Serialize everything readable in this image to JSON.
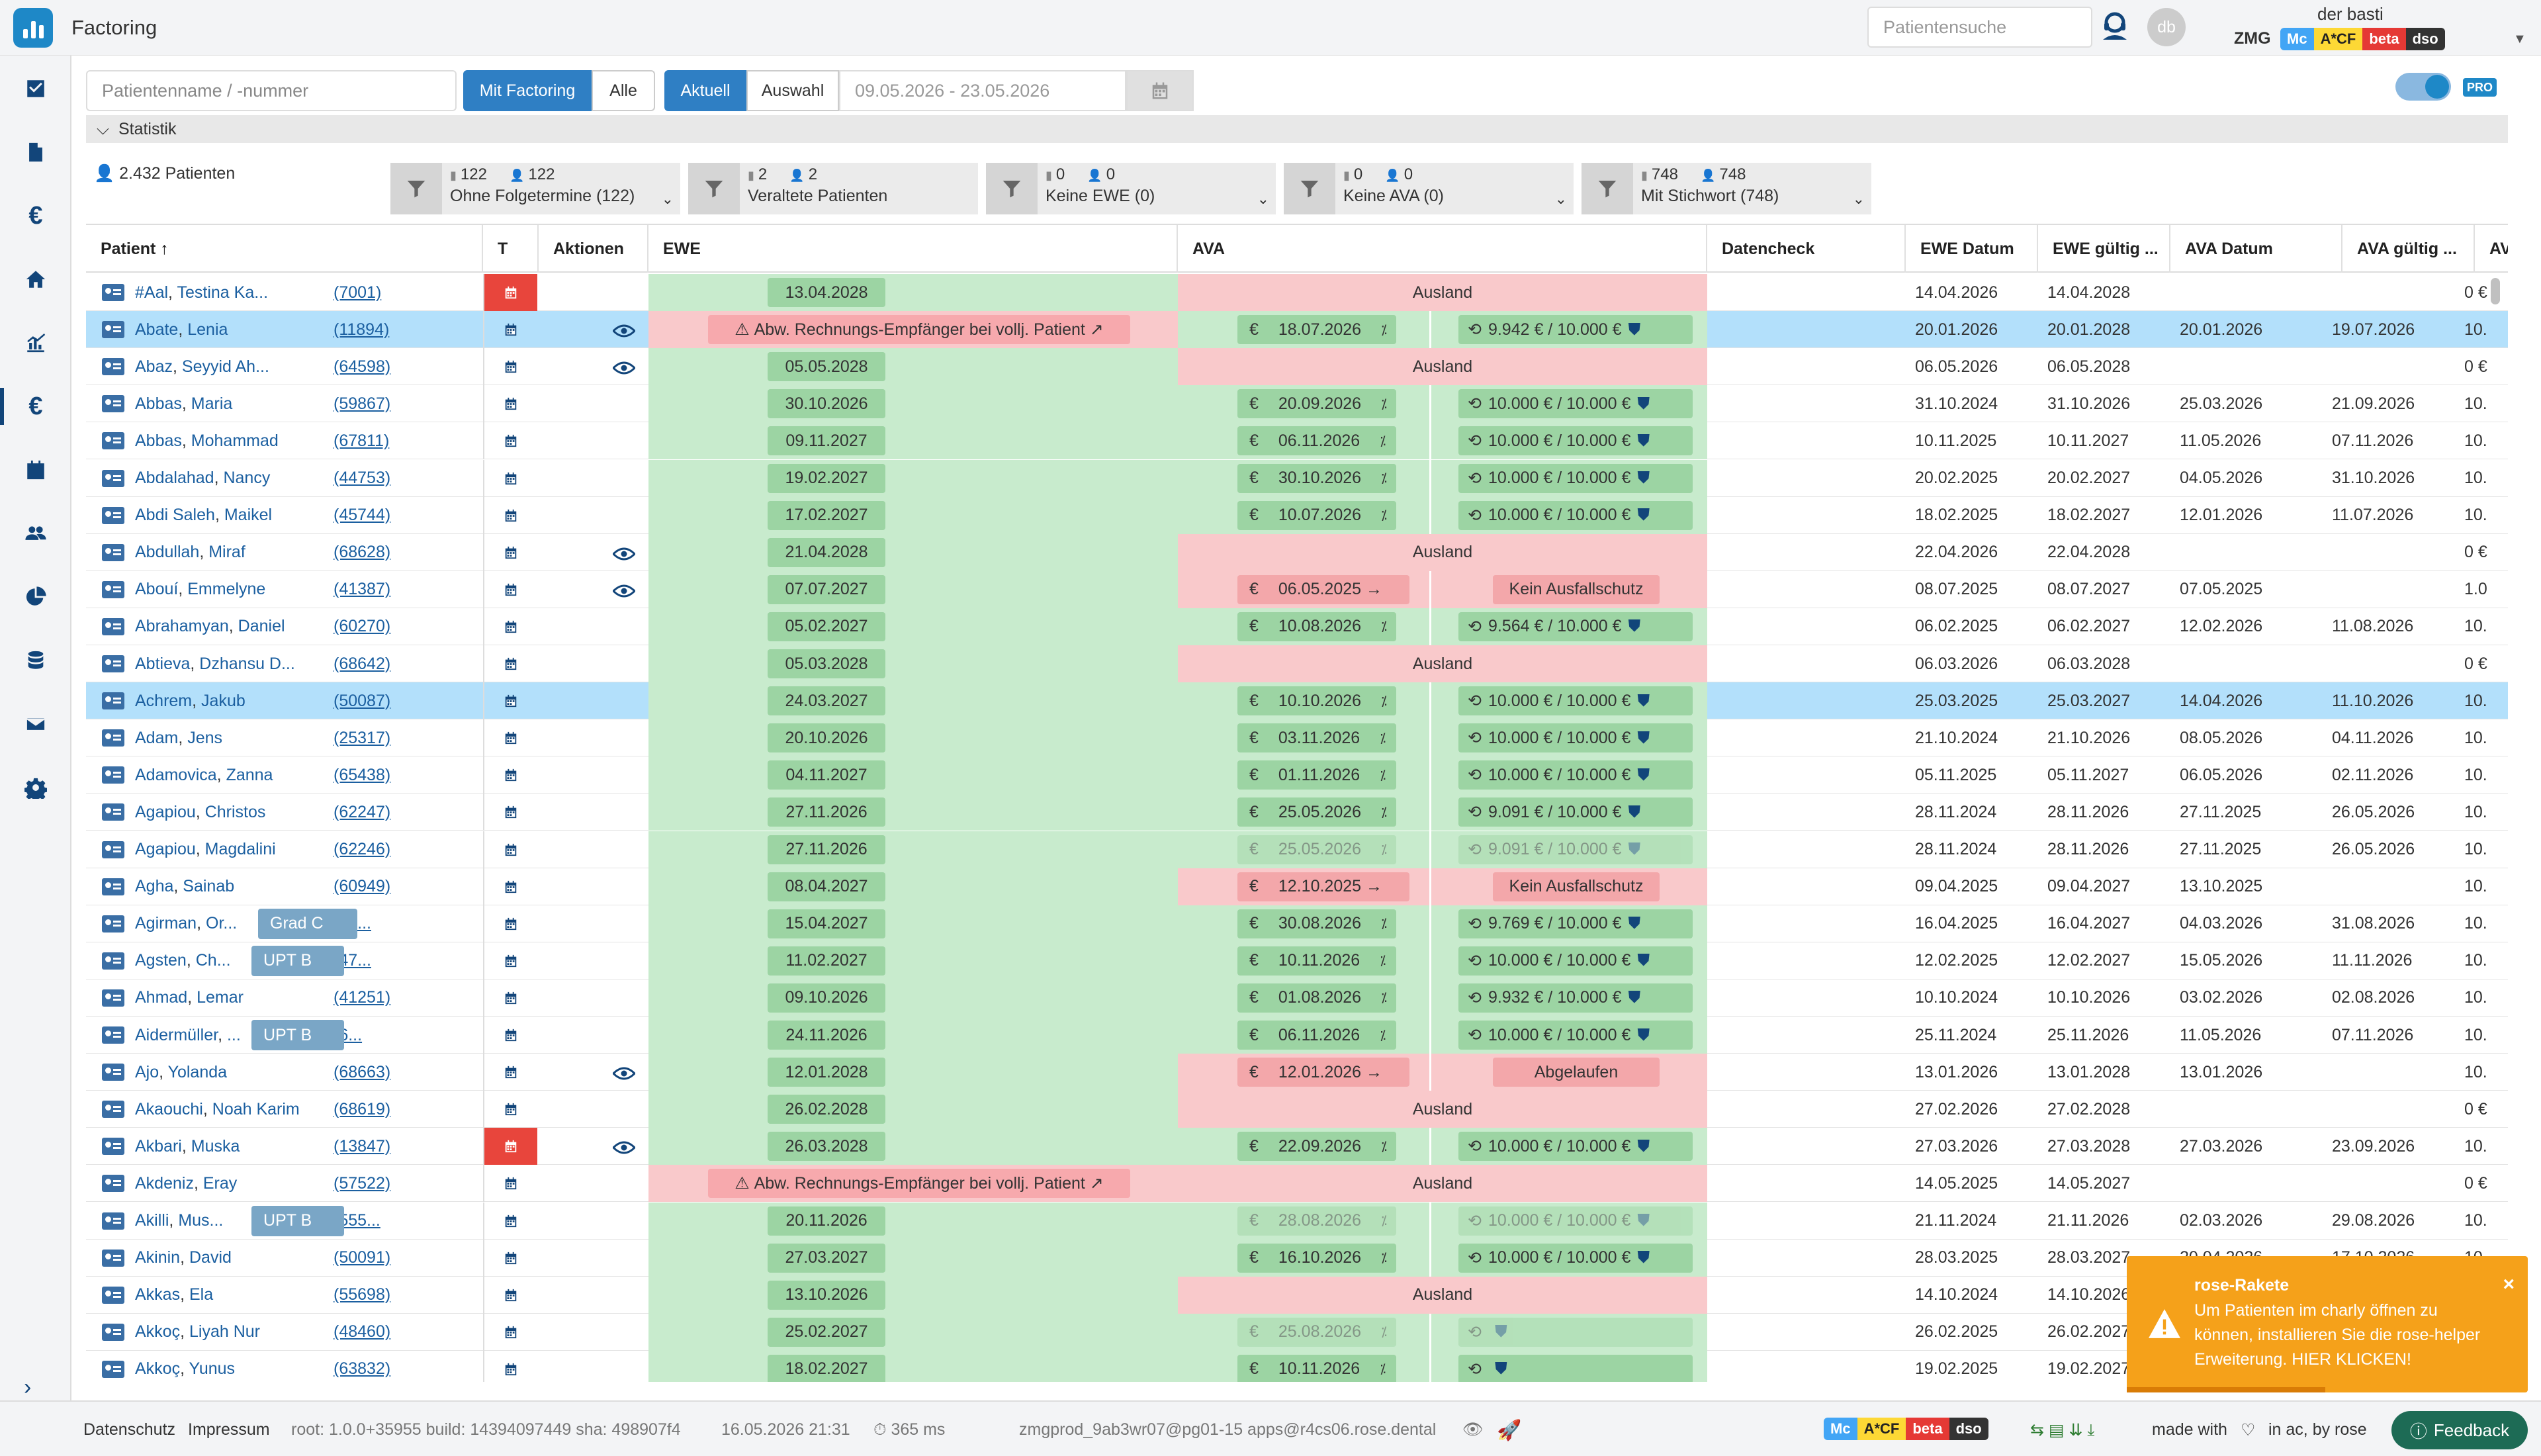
{
  "header": {
    "title": "Factoring",
    "search_placeholder": "Patientensuche",
    "avatar_initials": "db",
    "user_name": "der basti",
    "tenant": "ZMG",
    "badges": [
      "Mc",
      "A*CF",
      "beta",
      "dso"
    ]
  },
  "filters": {
    "name_placeholder": "Patientenname / -nummer",
    "mode_options": [
      "Mit Factoring",
      "Alle"
    ],
    "mode_selected": "Mit Factoring",
    "period_options": [
      "Aktuell",
      "Auswahl"
    ],
    "period_selected": "Aktuell",
    "date_range": "09.05.2026 - 23.05.2026",
    "pro_label": "PRO"
  },
  "statistics": {
    "title": "Statistik",
    "total": "2.432 Patienten",
    "filters": [
      {
        "count_a": "122",
        "count_b": "122",
        "selected": "Ohne Folgetermine (122)"
      },
      {
        "count_a": "2",
        "count_b": "2",
        "selected": "Veraltete Patienten"
      },
      {
        "count_a": "0",
        "count_b": "0",
        "selected": "Keine EWE (0)"
      },
      {
        "count_a": "0",
        "count_b": "0",
        "selected": "Keine AVA (0)"
      },
      {
        "count_a": "748",
        "count_b": "748",
        "selected": "Mit Stichwort (748)"
      }
    ]
  },
  "table": {
    "columns": [
      "Patient ↑",
      "T",
      "Aktionen",
      "EWE",
      "AVA",
      "Datencheck",
      "EWE Datum",
      "EWE gültig ...",
      "AVA Datum",
      "AVA gültig ...",
      "AVA B"
    ],
    "rows": [
      {
        "last": "#Aal",
        "first": "Testina Ka...",
        "num": "(7001)",
        "t_red": true,
        "eye": false,
        "ewe": "13.04.2028",
        "ewe_type": "green",
        "ava_type": "red-center",
        "ava_text": "Ausland",
        "ewe_datum": "14.04.2026",
        "ewe_gueltig": "14.04.2028",
        "ava_datum": "",
        "ava_gueltig": "",
        "ava_b": "0 €"
      },
      {
        "last": "Abate",
        "first": "Lenia",
        "num": "(11894)",
        "sel": true,
        "eye": true,
        "ewe": "Abw. Rechnungs-Empfänger bei vollj. Patient",
        "ewe_type": "warn",
        "ava_type": "green",
        "ava_a": "18.07.2026",
        "ava_b": "9.942 €  /  10.000 €",
        "ewe_datum": "20.01.2026",
        "ewe_gueltig": "20.01.2028",
        "ava_datum": "20.01.2026",
        "ava_gueltig": "19.07.2026",
        "ava_b_col": "10."
      },
      {
        "last": "Abaz",
        "first": "Seyyid Ah...",
        "num": "(64598)",
        "eye": true,
        "ewe": "05.05.2028",
        "ewe_type": "green",
        "ava_type": "red-center",
        "ava_text": "Ausland",
        "ewe_datum": "06.05.2026",
        "ewe_gueltig": "06.05.2028",
        "ava_datum": "",
        "ava_gueltig": "",
        "ava_b": "0 €"
      },
      {
        "last": "Abbas",
        "first": "Maria",
        "num": "(59867)",
        "ewe": "30.10.2026",
        "ewe_type": "green",
        "ava_type": "green",
        "ava_a": "20.09.2026",
        "ava_b": "10.000 €  /  10.000 €",
        "ewe_datum": "31.10.2024",
        "ewe_gueltig": "31.10.2026",
        "ava_datum": "25.03.2026",
        "ava_gueltig": "21.09.2026",
        "ava_b_col": "10."
      },
      {
        "last": "Abbas",
        "first": "Mohammad",
        "num": "(67811)",
        "ewe": "09.11.2027",
        "ewe_type": "green",
        "ava_type": "green",
        "ava_a": "06.11.2026",
        "ava_b": "10.000 €  /  10.000 €",
        "ewe_datum": "10.11.2025",
        "ewe_gueltig": "10.11.2027",
        "ava_datum": "11.05.2026",
        "ava_gueltig": "07.11.2026",
        "ava_b_col": "10."
      },
      {
        "last": "Abdalahad",
        "first": "Nancy",
        "num": "(44753)",
        "ewe": "19.02.2027",
        "ewe_type": "green",
        "ava_type": "green",
        "ava_a": "30.10.2026",
        "ava_b": "10.000 €  /  10.000 €",
        "ewe_datum": "20.02.2025",
        "ewe_gueltig": "20.02.2027",
        "ava_datum": "04.05.2026",
        "ava_gueltig": "31.10.2026",
        "ava_b_col": "10."
      },
      {
        "last": "Abdi Saleh",
        "first": "Maikel",
        "num": "(45744)",
        "ewe": "17.02.2027",
        "ewe_type": "green",
        "ava_type": "green",
        "ava_a": "10.07.2026",
        "ava_b": "10.000 €  /  10.000 €",
        "ewe_datum": "18.02.2025",
        "ewe_gueltig": "18.02.2027",
        "ava_datum": "12.01.2026",
        "ava_gueltig": "11.07.2026",
        "ava_b_col": "10."
      },
      {
        "last": "Abdullah",
        "first": "Miraf",
        "num": "(68628)",
        "eye": true,
        "ewe": "21.04.2028",
        "ewe_type": "green",
        "ava_type": "red-center",
        "ava_text": "Ausland",
        "ewe_datum": "22.04.2026",
        "ewe_gueltig": "22.04.2028",
        "ava_datum": "",
        "ava_gueltig": "",
        "ava_b": "0 €"
      },
      {
        "last": "Abouí",
        "first": "Emmelyne",
        "num": "(41387)",
        "eye": true,
        "ewe": "07.07.2027",
        "ewe_type": "green",
        "ava_type": "red-split",
        "ava_a": "06.05.2025 →",
        "ava_b": "Kein Ausfallschutz",
        "ewe_datum": "08.07.2025",
        "ewe_gueltig": "08.07.2027",
        "ava_datum": "07.05.2025",
        "ava_gueltig": "",
        "ava_b_col": "1.0"
      },
      {
        "last": "Abrahamyan",
        "first": "Daniel",
        "num": "(60270)",
        "ewe": "05.02.2027",
        "ewe_type": "green",
        "ava_type": "green",
        "ava_a": "10.08.2026",
        "ava_b": "9.564 €  /  10.000 €",
        "ewe_datum": "06.02.2025",
        "ewe_gueltig": "06.02.2027",
        "ava_datum": "12.02.2026",
        "ava_gueltig": "11.08.2026",
        "ava_b_col": "10."
      },
      {
        "last": "Abtieva",
        "first": "Dzhansu D...",
        "num": "(68642)",
        "ewe": "05.03.2028",
        "ewe_type": "green",
        "ava_type": "red-center",
        "ava_text": "Ausland",
        "ewe_datum": "06.03.2026",
        "ewe_gueltig": "06.03.2028",
        "ava_datum": "",
        "ava_gueltig": "",
        "ava_b": "0 €"
      },
      {
        "last": "Achrem",
        "first": "Jakub",
        "num": "(50087)",
        "sel": true,
        "ewe": "24.03.2027",
        "ewe_type": "green",
        "ava_type": "green",
        "ava_a": "10.10.2026",
        "ava_b": "10.000 €  /  10.000 €",
        "ewe_datum": "25.03.2025",
        "ewe_gueltig": "25.03.2027",
        "ava_datum": "14.04.2026",
        "ava_gueltig": "11.10.2026",
        "ava_b_col": "10."
      },
      {
        "last": "Adam",
        "first": "Jens",
        "num": "(25317)",
        "ewe": "20.10.2026",
        "ewe_type": "green",
        "ava_type": "green",
        "ava_a": "03.11.2026",
        "ava_b": "10.000 €  /  10.000 €",
        "ewe_datum": "21.10.2024",
        "ewe_gueltig": "21.10.2026",
        "ava_datum": "08.05.2026",
        "ava_gueltig": "04.11.2026",
        "ava_b_col": "10."
      },
      {
        "last": "Adamovica",
        "first": "Zanna",
        "num": "(65438)",
        "ewe": "04.11.2027",
        "ewe_type": "green",
        "ava_type": "green",
        "ava_a": "01.11.2026",
        "ava_b": "10.000 €  /  10.000 €",
        "ewe_datum": "05.11.2025",
        "ewe_gueltig": "05.11.2027",
        "ava_datum": "06.05.2026",
        "ava_gueltig": "02.11.2026",
        "ava_b_col": "10."
      },
      {
        "last": "Agapiou",
        "first": "Christos",
        "num": "(62247)",
        "ewe": "27.11.2026",
        "ewe_type": "green",
        "ava_type": "green",
        "ava_a": "25.05.2026",
        "ava_b": "9.091 €  /  10.000 €",
        "ewe_datum": "28.11.2024",
        "ewe_gueltig": "28.11.2026",
        "ava_datum": "27.11.2025",
        "ava_gueltig": "26.05.2026",
        "ava_b_col": "10."
      },
      {
        "last": "Agapiou",
        "first": "Magdalini",
        "num": "(62246)",
        "ewe": "27.11.2026",
        "ewe_type": "green",
        "ava_type": "green-fade",
        "ava_a": "25.05.2026",
        "ava_b": "9.091 €  /  10.000 €",
        "ewe_datum": "28.11.2024",
        "ewe_gueltig": "28.11.2026",
        "ava_datum": "27.11.2025",
        "ava_gueltig": "26.05.2026",
        "ava_b_col": "10."
      },
      {
        "last": "Agha",
        "first": "Sainab",
        "num": "(60949)",
        "ewe": "08.04.2027",
        "ewe_type": "green",
        "ava_type": "red-split",
        "ava_a": "12.10.2025 →",
        "ava_b": "Kein Ausfallschutz",
        "ewe_datum": "09.04.2025",
        "ewe_gueltig": "09.04.2027",
        "ava_datum": "13.10.2025",
        "ava_gueltig": "",
        "ava_b_col": "10."
      },
      {
        "last": "Agirman",
        "first": "Or...",
        "num": "(29...",
        "tag": "Grad C",
        "ewe": "15.04.2027",
        "ewe_type": "green",
        "ava_type": "green",
        "ava_a": "30.08.2026",
        "ava_b": "9.769 €  /  10.000 €",
        "ewe_datum": "16.04.2025",
        "ewe_gueltig": "16.04.2027",
        "ava_datum": "04.03.2026",
        "ava_gueltig": "31.08.2026",
        "ava_b_col": "10."
      },
      {
        "last": "Agsten",
        "first": "Ch...",
        "num": "(47...",
        "tag": "UPT B",
        "ewe": "11.02.2027",
        "ewe_type": "green",
        "ava_type": "green",
        "ava_a": "10.11.2026",
        "ava_b": "10.000 €  /  10.000 €",
        "ewe_datum": "12.02.2025",
        "ewe_gueltig": "12.02.2027",
        "ava_datum": "15.05.2026",
        "ava_gueltig": "11.11.2026",
        "ava_b_col": "10."
      },
      {
        "last": "Ahmad",
        "first": "Lemar",
        "num": "(41251)",
        "ewe": "09.10.2026",
        "ewe_type": "green",
        "ava_type": "green",
        "ava_a": "01.08.2026",
        "ava_b": "9.932 €  /  10.000 €",
        "ewe_datum": "10.10.2024",
        "ewe_gueltig": "10.10.2026",
        "ava_datum": "03.02.2026",
        "ava_gueltig": "02.08.2026",
        "ava_b_col": "10."
      },
      {
        "last": "Aidermüller",
        "first": "...",
        "num": "(6...",
        "tag": "UPT B",
        "ewe": "24.11.2026",
        "ewe_type": "green",
        "ava_type": "green",
        "ava_a": "06.11.2026",
        "ava_b": "10.000 €  /  10.000 €",
        "ewe_datum": "25.11.2024",
        "ewe_gueltig": "25.11.2026",
        "ava_datum": "11.05.2026",
        "ava_gueltig": "07.11.2026",
        "ava_b_col": "10."
      },
      {
        "last": "Ajo",
        "first": "Yolanda",
        "num": "(68663)",
        "eye": true,
        "ewe": "12.01.2028",
        "ewe_type": "green",
        "ava_type": "red-split",
        "ava_a": "12.01.2026 →",
        "ava_b": "Abgelaufen",
        "ewe_datum": "13.01.2026",
        "ewe_gueltig": "13.01.2028",
        "ava_datum": "13.01.2026",
        "ava_gueltig": "",
        "ava_b_col": "10."
      },
      {
        "last": "Akaouchi",
        "first": "Noah Karim",
        "num": "(68619)",
        "ewe": "26.02.2028",
        "ewe_type": "green",
        "ava_type": "red-center",
        "ava_text": "Ausland",
        "ewe_datum": "27.02.2026",
        "ewe_gueltig": "27.02.2028",
        "ava_datum": "",
        "ava_gueltig": "",
        "ava_b": "0 €"
      },
      {
        "last": "Akbari",
        "first": "Muska",
        "num": "(13847)",
        "t_red": true,
        "eye": true,
        "ewe": "26.03.2028",
        "ewe_type": "green",
        "ava_type": "green",
        "ava_a": "22.09.2026",
        "ava_b": "10.000 €  /  10.000 €",
        "ewe_datum": "27.03.2026",
        "ewe_gueltig": "27.03.2028",
        "ava_datum": "27.03.2026",
        "ava_gueltig": "23.09.2026",
        "ava_b_col": "10."
      },
      {
        "last": "Akdeniz",
        "first": "Eray",
        "num": "(57522)",
        "ewe": "Abw. Rechnungs-Empfänger bei vollj. Patient",
        "ewe_type": "warn",
        "ava_type": "red-center",
        "ava_text": "Ausland",
        "ewe_datum": "14.05.2025",
        "ewe_gueltig": "14.05.2027",
        "ava_datum": "",
        "ava_gueltig": "",
        "ava_b": "0 €"
      },
      {
        "last": "Akilli",
        "first": "Mus...",
        "num": "(555...",
        "tag": "UPT B",
        "ewe": "20.11.2026",
        "ewe_type": "green",
        "ava_type": "green-fade",
        "ava_a": "28.08.2026",
        "ava_b": "10.000 €  /  10.000 €",
        "ewe_datum": "21.11.2024",
        "ewe_gueltig": "21.11.2026",
        "ava_datum": "02.03.2026",
        "ava_gueltig": "29.08.2026",
        "ava_b_col": "10."
      },
      {
        "last": "Akinin",
        "first": "David",
        "num": "(50091)",
        "ewe": "27.03.2027",
        "ewe_type": "green",
        "ava_type": "green",
        "ava_a": "16.10.2026",
        "ava_b": "10.000 €  /  10.000 €",
        "ewe_datum": "28.03.2025",
        "ewe_gueltig": "28.03.2027",
        "ava_datum": "20.04.2026",
        "ava_gueltig": "17.10.2026",
        "ava_b_col": "10."
      },
      {
        "last": "Akkas",
        "first": "Ela",
        "num": "(55698)",
        "ewe": "13.10.2026",
        "ewe_type": "green",
        "ava_type": "red-center",
        "ava_text": "Ausland",
        "ewe_datum": "14.10.2024",
        "ewe_gueltig": "14.10.2026",
        "ava_datum": "",
        "ava_gueltig": "",
        "ava_b": ""
      },
      {
        "last": "Akkoç",
        "first": "Liyah Nur",
        "num": "(48460)",
        "ewe": "25.02.2027",
        "ewe_type": "green",
        "ava_type": "green-fade",
        "ava_a": "25.08.2026",
        "ava_b": "",
        "ewe_datum": "26.02.2025",
        "ewe_gueltig": "26.02.2027",
        "ava_datum": "",
        "ava_gueltig": ""
      },
      {
        "last": "Akkoç",
        "first": "Yunus",
        "num": "(63832)",
        "ewe": "18.02.2027",
        "ewe_type": "green",
        "ava_type": "green",
        "ava_a": "10.11.2026",
        "ava_b": "",
        "ewe_datum": "19.02.2025",
        "ewe_gueltig": "19.02.2027",
        "ava_datum": "",
        "ava_gueltig": ""
      }
    ]
  },
  "toast": {
    "title": "rose-Rakete",
    "message": "Um Patienten im charly öffnen zu können, installieren Sie die rose-helper Erweiterung. HIER KLICKEN!",
    "close": "×"
  },
  "footer": {
    "privacy": "Datenschutz",
    "imprint": "Impressum",
    "version": "root: 1.0.0+35955 build: 14394097449 sha: 498907f4",
    "datetime": "16.05.2026 21:31",
    "latency": "365 ms",
    "server": "zmgprod_9ab3wr07@pg01-15 apps@r4cs06.rose.dental",
    "made_with": "made with",
    "made_by": "in ac, by rose",
    "feedback": "Feedback",
    "badges": [
      "Mc",
      "A*CF",
      "beta",
      "dso"
    ]
  },
  "colors": {
    "brand": "#1e88c7",
    "nav": "#12457a",
    "green_cell": "#c8ebcd",
    "green_pill": "#9cd4a3",
    "red_cell": "#f9c9cb",
    "selected_row": "#b3e0fb",
    "toast": "#f5a11a"
  }
}
